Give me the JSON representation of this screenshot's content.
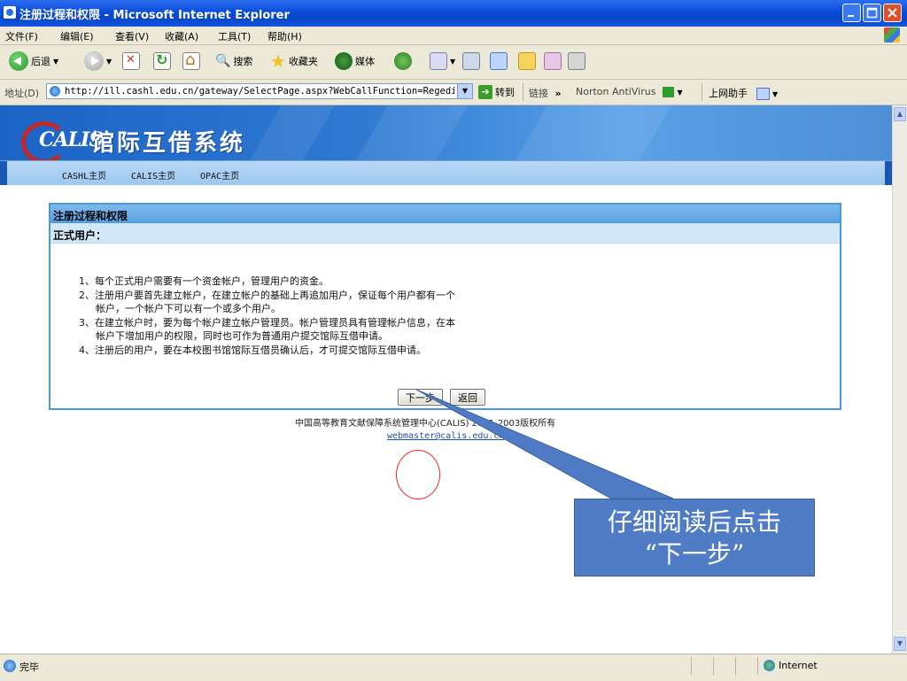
{
  "window": {
    "title": "注册过程和权限 - Microsoft Internet Explorer"
  },
  "menubar": {
    "items": [
      "文件(F)",
      "编辑(E)",
      "查看(V)",
      "收藏(A)",
      "工具(T)",
      "帮助(H)"
    ]
  },
  "toolbar": {
    "back_label": "后退",
    "search_label": "搜索",
    "favorites_label": "收藏夹",
    "media_label": "媒体"
  },
  "addressbar": {
    "label": "地址(D)",
    "url": "http://ill.cashl.edu.cn/gateway/SelectPage.aspx?WebCallFunction=Regedit&",
    "go_label": "转到",
    "links_label": "链接",
    "more_label": "»",
    "norton_label": "Norton AntiVirus",
    "helper_label": "上网助手"
  },
  "banner": {
    "logo_text": "CALIS",
    "system_name": "馆际互借系统",
    "nav_links": [
      "CASHL主页",
      "CALIS主页",
      "OPAC主页"
    ]
  },
  "panel": {
    "header": "注册过程和权限",
    "subheader": "正式用户：",
    "rules": [
      "1、每个正式用户需要有一个资金帐户，管理用户的资金。",
      "2、注册用户要首先建立帐户，在建立帐户的基础上再追加用户，保证每个用户都有一个",
      "帐户，一个帐户下可以有一个或多个用户。",
      "3、在建立帐户时，要为每个帐户建立帐户管理员。帐户管理员具有管理帐户信息，在本",
      "帐户下增加用户的权限，同时也可作为普通用户提交馆际互借申请。",
      "4、注册后的用户，要在本校图书馆馆际互借员确认后，才可提交馆际互借申请。"
    ],
    "next_button": "下一步",
    "back_button": "返回"
  },
  "footer": {
    "copyright": "中国高等教育文献保障系统管理中心(CALIS) 2001-2003版权所有",
    "email": "webmaster@calis.edu.cn"
  },
  "annotation": {
    "text_line1": "仔细阅读后点击",
    "text_line2": "“下一步”"
  },
  "statusbar": {
    "status": "完毕",
    "zone": "Internet"
  }
}
